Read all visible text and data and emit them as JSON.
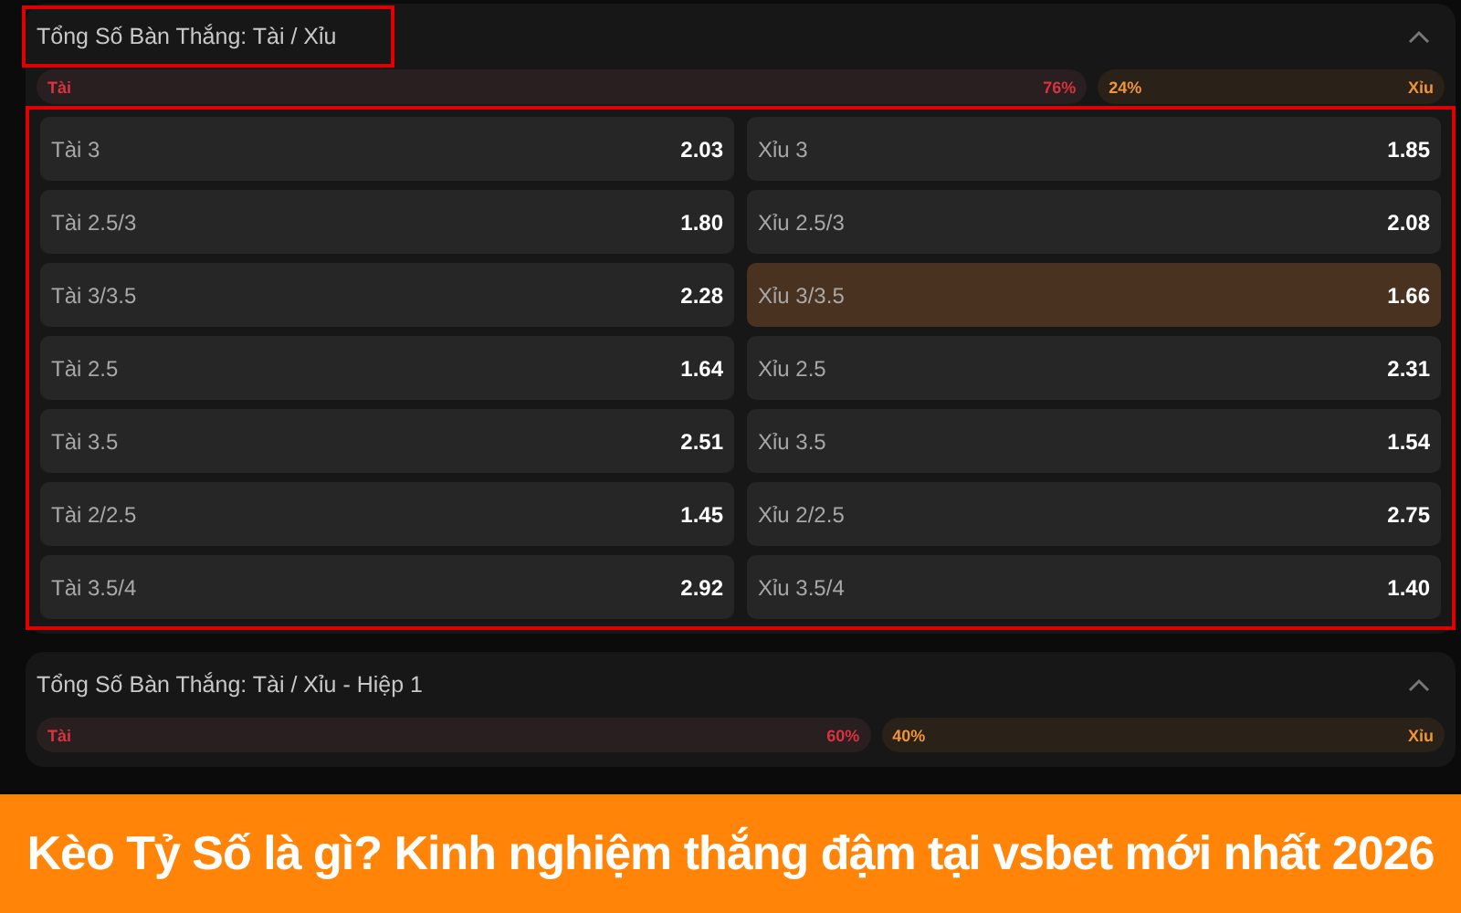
{
  "markets": [
    {
      "title": "Tổng Số Bàn Thắng: Tài / Xỉu",
      "highlighted": true,
      "expanded": true,
      "split": {
        "left_label": "Tài",
        "left_pct": "76%",
        "level": 0.76,
        "right_pct": "24%",
        "right_label": "Xỉu"
      },
      "odds": {
        "highlighted": true,
        "rows": [
          [
            {
              "label": "Tài 3",
              "odd": "2.03",
              "selected": false
            },
            {
              "label": "Xỉu 3",
              "odd": "1.85",
              "selected": false
            }
          ],
          [
            {
              "label": "Tài 2.5/3",
              "odd": "1.80",
              "selected": false
            },
            {
              "label": "Xỉu 2.5/3",
              "odd": "2.08",
              "selected": false
            }
          ],
          [
            {
              "label": "Tài 3/3.5",
              "odd": "2.28",
              "selected": false
            },
            {
              "label": "Xỉu 3/3.5",
              "odd": "1.66",
              "selected": true
            }
          ],
          [
            {
              "label": "Tài 2.5",
              "odd": "1.64",
              "selected": false
            },
            {
              "label": "Xỉu 2.5",
              "odd": "2.31",
              "selected": false
            }
          ],
          [
            {
              "label": "Tài 3.5",
              "odd": "2.51",
              "selected": false
            },
            {
              "label": "Xỉu 3.5",
              "odd": "1.54",
              "selected": false
            }
          ],
          [
            {
              "label": "Tài 2/2.5",
              "odd": "1.45",
              "selected": false
            },
            {
              "label": "Xỉu 2/2.5",
              "odd": "2.75",
              "selected": false
            }
          ],
          [
            {
              "label": "Tài 3.5/4",
              "odd": "2.92",
              "selected": false
            },
            {
              "label": "Xỉu 3.5/4",
              "odd": "1.40",
              "selected": false
            }
          ]
        ]
      }
    },
    {
      "title": "Tổng Số Bàn Thắng: Tài / Xỉu - Hiệp 1",
      "highlighted": false,
      "expanded": true,
      "split": {
        "left_label": "Tài",
        "left_pct": "60%",
        "level": 0.6,
        "right_pct": "40%",
        "right_label": "Xỉu"
      }
    }
  ],
  "banner": {
    "text": "Kèo Tỷ Số là gì? Kinh nghiệm thắng đậm tại vsbet mới nhất 2026"
  }
}
